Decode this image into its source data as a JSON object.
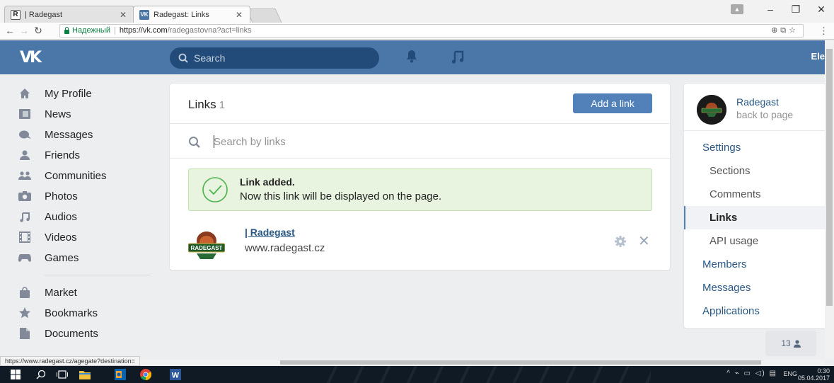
{
  "browser": {
    "tabs": [
      {
        "title": "| Radegast",
        "favicon": "R"
      },
      {
        "title": "Radegast: Links",
        "favicon": "VK"
      }
    ],
    "secure_label": "Надежный",
    "url_host": "https://vk.com",
    "url_path": "/radegastovna?act=links",
    "status_url": "https://www.radegast.cz/agegate?destination="
  },
  "header": {
    "logo": "VK",
    "search_placeholder": "Search",
    "user_name": "Ele"
  },
  "left_nav": {
    "items": [
      {
        "label": "My Profile",
        "icon": "home-icon"
      },
      {
        "label": "News",
        "icon": "news-icon"
      },
      {
        "label": "Messages",
        "icon": "messages-icon"
      },
      {
        "label": "Friends",
        "icon": "friends-icon"
      },
      {
        "label": "Communities",
        "icon": "communities-icon"
      },
      {
        "label": "Photos",
        "icon": "camera-icon"
      },
      {
        "label": "Audios",
        "icon": "music-icon"
      },
      {
        "label": "Videos",
        "icon": "film-icon"
      },
      {
        "label": "Games",
        "icon": "gamepad-icon"
      },
      {
        "label": "Market",
        "icon": "bag-icon"
      },
      {
        "label": "Bookmarks",
        "icon": "star-icon"
      },
      {
        "label": "Documents",
        "icon": "document-icon"
      }
    ]
  },
  "main": {
    "title": "Links",
    "count": "1",
    "add_button": "Add a link",
    "search_placeholder": "Search by links",
    "notice": {
      "title": "Link added.",
      "text": "Now this link will be displayed on the page."
    },
    "links": [
      {
        "title": "| Radegast",
        "url": "www.radegast.cz",
        "logo_text": "RADEGAST"
      }
    ]
  },
  "right_menu": {
    "group_name": "Radegast",
    "back_label": "back to page",
    "items": [
      {
        "label": "Settings",
        "kind": "top"
      },
      {
        "label": "Sections",
        "kind": "sub"
      },
      {
        "label": "Comments",
        "kind": "sub"
      },
      {
        "label": "Links",
        "kind": "sub",
        "active": true
      },
      {
        "label": "API usage",
        "kind": "sub"
      },
      {
        "label": "Members",
        "kind": "top"
      },
      {
        "label": "Messages",
        "kind": "top"
      },
      {
        "label": "Applications",
        "kind": "top"
      }
    ]
  },
  "online_counter": "13",
  "taskbar": {
    "lang": "ENG",
    "time": "0:30",
    "date": "05.04.2017"
  },
  "colors": {
    "vk_blue": "#4a76a8",
    "button_blue": "#5181b8",
    "link_blue": "#2a5885",
    "success_bg": "#e8f4e0",
    "success_icon": "#4bb34b"
  }
}
